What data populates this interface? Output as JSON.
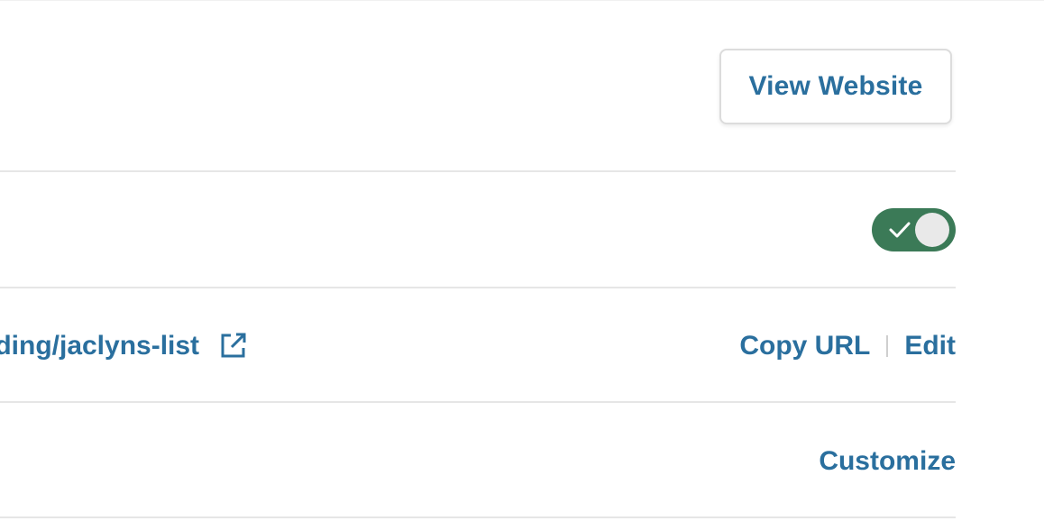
{
  "header": {
    "view_website_label": "View Website"
  },
  "publish_toggle": {
    "state": "on",
    "color": "#3b7a57"
  },
  "url_row": {
    "url_text": "lding/jaclyns-list",
    "external_icon": "external-link-icon",
    "copy_label": "Copy URL",
    "separator": "|",
    "edit_label": "Edit"
  },
  "customize_row": {
    "customize_label": "Customize"
  },
  "colors": {
    "link": "#2a6f9e",
    "divider": "#e6e6e6"
  }
}
